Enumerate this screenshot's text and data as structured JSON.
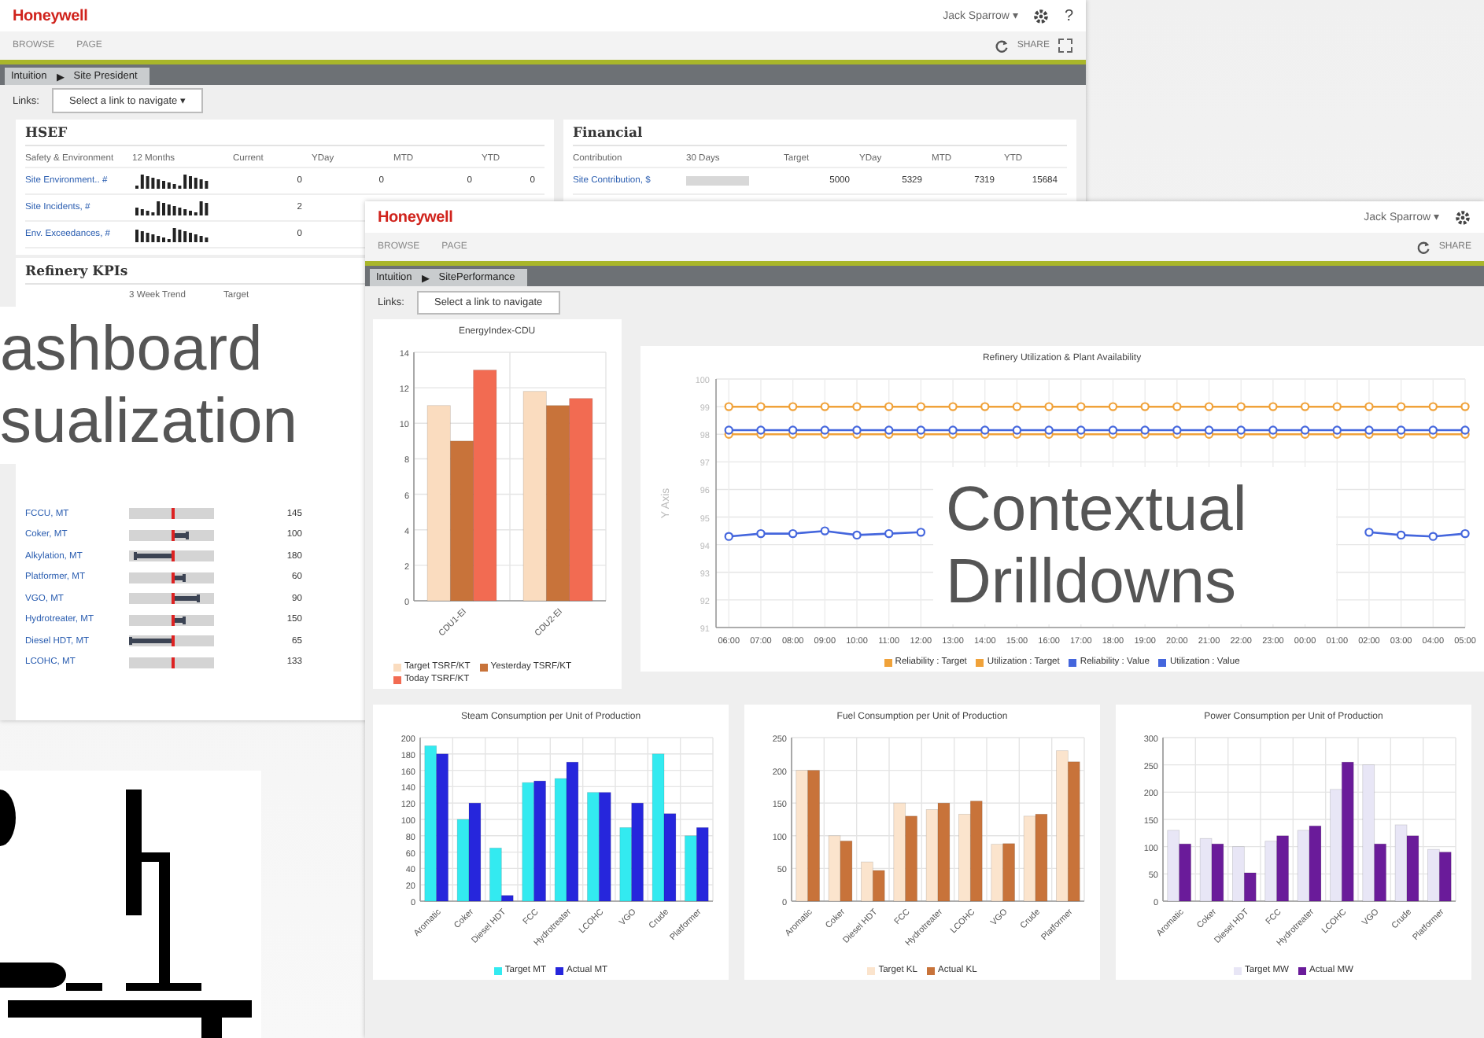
{
  "back_window": {
    "logo": "Honeywell",
    "user": "Jack Sparrow ▾",
    "help": "?",
    "menu": [
      "BROWSE",
      "PAGE"
    ],
    "share": "SHARE",
    "breadcrumb": {
      "items": [
        "Intuition",
        "Site President"
      ],
      "separator": "▶"
    },
    "links_label": "Links:",
    "links_select": "Select a link to navigate ▾",
    "hsef": {
      "title": "HSEF",
      "columns": [
        "Safety & Environment",
        "12 Months",
        "Current",
        "YDay",
        "MTD",
        "YTD"
      ],
      "rows": [
        {
          "name": "Site Environment.. #",
          "cells": [
            "0",
            "0",
            "0",
            "0"
          ]
        },
        {
          "name": "Site Incidents, #",
          "cells": [
            "2"
          ]
        },
        {
          "name": "Env. Exceedances, #",
          "cells": [
            "0"
          ]
        }
      ]
    },
    "financial": {
      "title": "Financial",
      "columns": [
        "Contribution",
        "30 Days",
        "Target",
        "YDay",
        "MTD",
        "YTD"
      ],
      "rows": [
        {
          "name": "Site Contribution, $",
          "cells": [
            "5000",
            "5329",
            "7319",
            "15684"
          ]
        }
      ]
    },
    "refinery_kpis": {
      "title": "Refinery KPIs",
      "columns": [
        "3 Week Trend",
        "Target"
      ],
      "rows": [
        {
          "name": "FCCU, MT",
          "level": 0.5,
          "target": "145"
        },
        {
          "name": "Coker, MT",
          "level": 0.68,
          "target": "100"
        },
        {
          "name": "Alkylation, MT",
          "level": 0.07,
          "target": "180"
        },
        {
          "name": "Platformer, MT",
          "level": 0.64,
          "target": "60"
        },
        {
          "name": "VGO, MT",
          "level": 0.81,
          "target": "90"
        },
        {
          "name": "Hydrotreater, MT",
          "level": 0.64,
          "target": "150"
        },
        {
          "name": "Diesel HDT, MT",
          "level": 0.02,
          "target": "65"
        },
        {
          "name": "LCOHC, MT",
          "level": 0.5,
          "target": "133"
        }
      ]
    }
  },
  "front_window": {
    "logo": "Honeywell",
    "user": "Jack Sparrow ▾",
    "menu": [
      "BROWSE",
      "PAGE"
    ],
    "share": "SHARE",
    "breadcrumb": {
      "items": [
        "Intuition",
        "SitePerformance"
      ],
      "separator": "▶"
    },
    "links_label": "Links:",
    "links_select": "Select a link to navigate",
    "energy": {
      "chart_data": {
        "type": "bar",
        "grid": true,
        "title": "EnergyIndex-CDU",
        "categories": [
          "CDU1-EI",
          "CDU2-EI"
        ],
        "ylim": [
          0,
          14
        ],
        "yticks": [
          0,
          2,
          4,
          6,
          8,
          10,
          12,
          14
        ],
        "series": [
          {
            "name": "Target TSRF/KT",
            "color": "#fadcbf",
            "values": [
              11,
              11.8
            ]
          },
          {
            "name": "Yesterday TSRF/KT",
            "color": "#c8733a",
            "values": [
              9,
              11
            ]
          },
          {
            "name": "Today TSRF/KT",
            "color": "#f26b52",
            "values": [
              13,
              11.4
            ]
          }
        ]
      }
    },
    "utilization": {
      "chart_data": {
        "type": "line",
        "grid": true,
        "title": "Refinery Utilization & Plant Availability",
        "ylabel": "Y Axis",
        "x": [
          "06:00",
          "07:00",
          "08:00",
          "09:00",
          "10:00",
          "11:00",
          "12:00",
          "13:00",
          "14:00",
          "15:00",
          "16:00",
          "17:00",
          "18:00",
          "19:00",
          "20:00",
          "21:00",
          "22:00",
          "23:00",
          "00:00",
          "01:00",
          "02:00",
          "03:00",
          "04:00",
          "05:00"
        ],
        "ylim": [
          91,
          100
        ],
        "yticks": [
          91,
          92,
          93,
          94,
          95,
          96,
          97,
          98,
          99,
          100
        ],
        "series": [
          {
            "name": "Reliability : Target",
            "color": "#f0a23a",
            "marker": "circle",
            "values": [
              99,
              99,
              99,
              99,
              99,
              99,
              99,
              99,
              99,
              99,
              99,
              99,
              99,
              99,
              99,
              99,
              99,
              99,
              99,
              99,
              99,
              99,
              99,
              99
            ]
          },
          {
            "name": "Utilization : Target",
            "color": "#f0a23a",
            "marker": "circle",
            "values": [
              98,
              98,
              98,
              98,
              98,
              98,
              98,
              98,
              98,
              98,
              98,
              98,
              98,
              98,
              98,
              98,
              98,
              98,
              98,
              98,
              98,
              98,
              98,
              98
            ]
          },
          {
            "name": "Reliability : Value",
            "color": "#4466dd",
            "marker": "circle",
            "values": [
              98.15,
              98.15,
              98.15,
              98.15,
              98.15,
              98.15,
              98.15,
              98.15,
              98.15,
              98.15,
              98.15,
              98.15,
              98.15,
              98.15,
              98.15,
              98.15,
              98.15,
              98.15,
              98.15,
              98.15,
              98.15,
              98.15,
              98.15,
              98.15
            ]
          },
          {
            "name": "Utilization : Value",
            "color": "#4466dd",
            "marker": "circle",
            "values": [
              94.3,
              94.4,
              94.4,
              94.5,
              94.35,
              94.4,
              94.45,
              null,
              null,
              null,
              null,
              null,
              null,
              null,
              null,
              null,
              null,
              null,
              null,
              null,
              94.45,
              94.35,
              94.3,
              94.4
            ]
          }
        ]
      }
    },
    "consumption": [
      {
        "chart_data": {
          "type": "bar",
          "grid": true,
          "title": "Steam Consumption per Unit of Production",
          "categories": [
            "Aromatic",
            "Coker",
            "Diesel HDT",
            "FCC",
            "Hydrotreater",
            "LCOHC",
            "VGO",
            "Crude",
            "Platformer"
          ],
          "ylim": [
            0,
            200
          ],
          "yticks": [
            0,
            20,
            40,
            60,
            80,
            100,
            120,
            140,
            160,
            180,
            200
          ],
          "series": [
            {
              "name": "Target MT",
              "color": "#33eaf0",
              "values": [
                190,
                100,
                65,
                145,
                150,
                133,
                90,
                180,
                80
              ]
            },
            {
              "name": "Actual MT",
              "color": "#2626dc",
              "values": [
                180,
                120,
                7,
                147,
                170,
                133,
                120,
                107,
                90
              ]
            }
          ]
        }
      },
      {
        "chart_data": {
          "type": "bar",
          "grid": true,
          "title": "Fuel Consumption per Unit of Production",
          "categories": [
            "Aromatic",
            "Coker",
            "Diesel HDT",
            "FCC",
            "Hydrotreater",
            "LCOHC",
            "VGO",
            "Crude",
            "Platformer"
          ],
          "ylim": [
            0,
            250
          ],
          "yticks": [
            0,
            50,
            100,
            150,
            200,
            250
          ],
          "series": [
            {
              "name": "Target KL",
              "color": "#fbe4cd",
              "values": [
                200,
                100,
                60,
                150,
                140,
                133,
                87,
                130,
                230
              ]
            },
            {
              "name": "Actual KL",
              "color": "#c8733a",
              "values": [
                200,
                92,
                47,
                130,
                150,
                153,
                88,
                133,
                213
              ]
            }
          ]
        }
      },
      {
        "chart_data": {
          "type": "bar",
          "grid": true,
          "title": "Power Consumption per Unit of Production",
          "categories": [
            "Aromatic",
            "Coker",
            "Diesel HDT",
            "FCC",
            "Hydrotreater",
            "LCOHC",
            "VGO",
            "Crude",
            "Platformer"
          ],
          "ylim": [
            0,
            300
          ],
          "yticks": [
            0,
            50,
            100,
            150,
            200,
            250,
            300
          ],
          "series": [
            {
              "name": "Target MW",
              "color": "#e8e6f6",
              "values": [
                130,
                115,
                100,
                110,
                130,
                205,
                250,
                140,
                95
              ]
            },
            {
              "name": "Actual MW",
              "color": "#6a1b9a",
              "values": [
                105,
                105,
                52,
                120,
                138,
                255,
                105,
                120,
                90
              ]
            }
          ]
        }
      }
    ]
  },
  "captions": [
    "ashboard sualization",
    "Contextual Drilldowns"
  ]
}
